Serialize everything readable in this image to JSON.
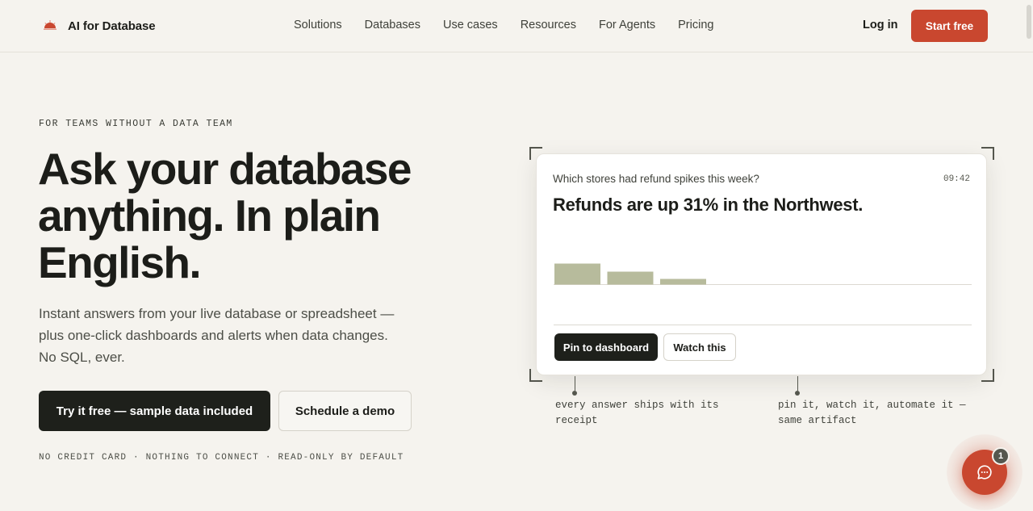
{
  "header": {
    "brand": "AI for Database",
    "nav": [
      "Solutions",
      "Databases",
      "Use cases",
      "Resources",
      "For Agents",
      "Pricing"
    ],
    "login": "Log in",
    "start": "Start free"
  },
  "hero": {
    "eyebrow": "FOR TEAMS WITHOUT A DATA TEAM",
    "title_line1": "Ask your database",
    "title_line2": "anything. In plain",
    "title_line3": "English.",
    "subtitle": "Instant answers from your live database or spreadsheet — plus one-click dashboards and alerts when data changes. No SQL, ever.",
    "cta_primary": "Try it free — sample data included",
    "cta_secondary": "Schedule a demo",
    "fineprint": "NO CREDIT CARD · NOTHING TO CONNECT · READ-ONLY BY DEFAULT"
  },
  "card": {
    "question": "Which stores had refund spikes this week?",
    "time": "09:42",
    "answer": "Refunds are up 31% in the Northwest.",
    "pin": "Pin to dashboard",
    "watch": "Watch this"
  },
  "chart_data": {
    "type": "bar",
    "values": [
      26,
      16,
      7
    ],
    "colors": [
      "#b7bb9c",
      "#b7bb9c",
      "#b7bb9c"
    ]
  },
  "annotations": [
    "every answer ships with its receipt",
    "pin it, watch it, automate it — same artifact"
  ],
  "chat": {
    "badge": "1",
    "accent": "#c9472f"
  },
  "colors": {
    "accent": "#c9472f",
    "dark": "#1e201b",
    "background": "#f5f3ee"
  }
}
